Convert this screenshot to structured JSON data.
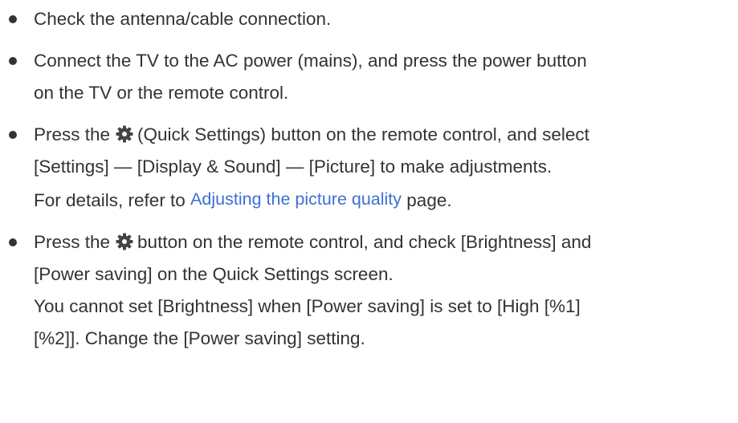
{
  "colors": {
    "text": "#333333",
    "link": "#3d6fd6",
    "icon": "#444444"
  },
  "icons": {
    "quick_settings": "gear-icon"
  },
  "items": [
    {
      "text": "Check the antenna/cable connection."
    },
    {
      "line1": "Connect the TV to the AC power (mains), and press the power button",
      "line2": "on the TV or the remote control."
    },
    {
      "line1_pre": "Press the",
      "line1_post": "(Quick Settings) button on the remote control, and select",
      "line2": "[Settings] — [Display & Sound] — [Picture] to make adjustments.",
      "line3_pre": "For details, refer to",
      "link": "Adjusting the picture quality",
      "line3_post": "page."
    },
    {
      "line1_pre": "Press the",
      "line1_post": "button on the remote control, and check [Brightness] and",
      "line2": "[Power saving] on the Quick Settings screen.",
      "line3": "You cannot set [Brightness] when [Power saving] is set to [High [%1]",
      "line4": "[%2]]. Change the [Power saving] setting."
    }
  ]
}
